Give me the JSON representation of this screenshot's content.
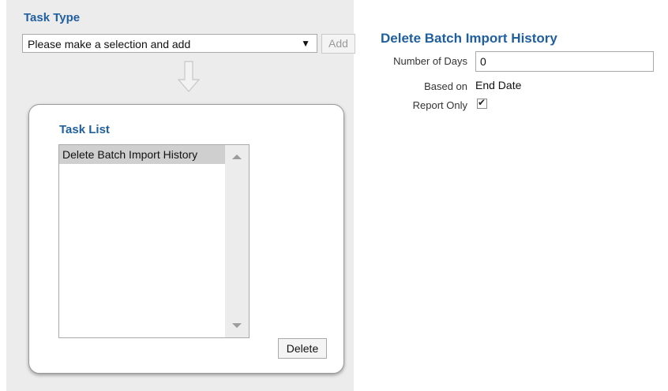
{
  "task_type": {
    "title": "Task Type",
    "select_value": "Please make a selection and add",
    "select_arrow": "▼",
    "add_label": "Add"
  },
  "task_list": {
    "title": "Task List",
    "items": [
      "Delete Batch Import History"
    ],
    "delete_label": "Delete"
  },
  "details": {
    "title": "Delete Batch Import History",
    "number_of_days_label": "Number of Days",
    "number_of_days_value": "0",
    "based_on_label": "Based on",
    "based_on_value": "End Date",
    "report_only_label": "Report Only",
    "report_only_checked": true
  },
  "colors": {
    "accent": "#1f5f9f",
    "panel_bg": "#ececec"
  },
  "icons": {
    "down_arrow": "down-arrow-icon",
    "scroll_up": "scroll-up-icon",
    "scroll_down": "scroll-down-icon",
    "checkmark": "checkmark-icon"
  }
}
